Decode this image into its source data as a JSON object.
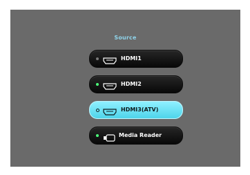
{
  "title": "Source",
  "items": [
    {
      "label": "HDMI1",
      "icon": "hdmi-icon",
      "status": "inactive"
    },
    {
      "label": "HDMI2",
      "icon": "hdmi-icon",
      "status": "active"
    },
    {
      "label": "HDMI3(ATV)",
      "icon": "hdmi-icon",
      "status": "selected"
    },
    {
      "label": "Media Reader",
      "icon": "usb-icon",
      "status": "active"
    }
  ],
  "colors": {
    "background": "#6a6a6a",
    "title": "#8fd3ea",
    "selected": "#5fdcee",
    "active_dot": "#4cff7a",
    "inactive_dot": "#7a7a7a"
  }
}
